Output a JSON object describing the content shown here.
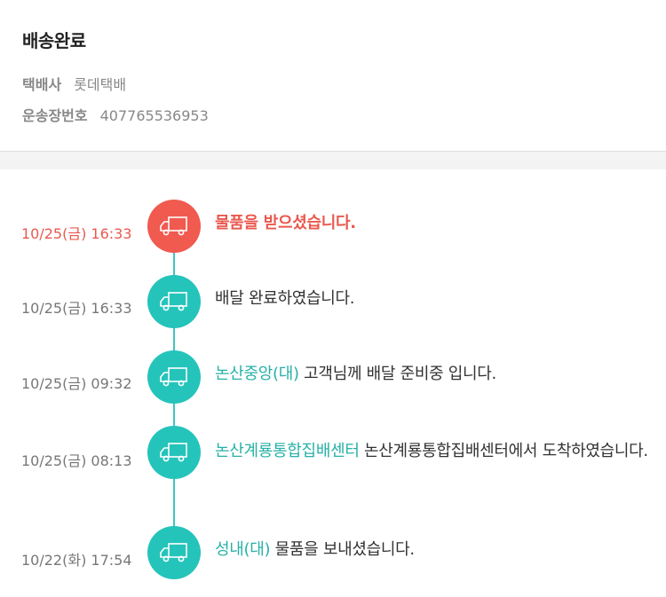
{
  "header": {
    "title": "배송완료",
    "courier_label": "택배사",
    "courier_value": "롯데택배",
    "tracking_label": "운송장번호",
    "tracking_value": "407765536953"
  },
  "colors": {
    "accent": "#25c4bb",
    "highlight": "#f05a4f",
    "location_text": "#27b1a7"
  },
  "events": [
    {
      "time": "10/25(금) 16:33",
      "location": "",
      "message": "물품을 받으셨습니다.",
      "icon": "truck-icon",
      "highlight": true
    },
    {
      "time": "10/25(금) 16:33",
      "location": "",
      "message": "배달 완료하였습니다.",
      "icon": "truck-icon",
      "highlight": false
    },
    {
      "time": "10/25(금) 09:32",
      "location": "논산중앙(대)",
      "message": "고객님께 배달 준비중 입니다.",
      "icon": "truck-icon",
      "highlight": false
    },
    {
      "time": "10/25(금) 08:13",
      "location": "논산계룡통합집배센터",
      "message": "논산계룡통합집배센터에서 도착하였습니다.",
      "icon": "truck-icon",
      "highlight": false
    },
    {
      "time": "10/22(화) 17:54",
      "location": "성내(대)",
      "message": "물품을 보내셨습니다.",
      "icon": "truck-icon",
      "highlight": false
    }
  ]
}
